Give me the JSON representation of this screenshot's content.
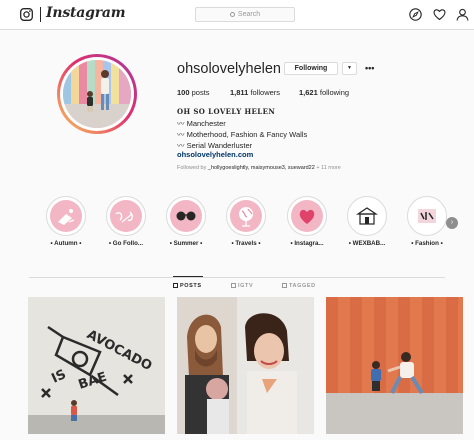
{
  "header": {
    "app_name": "Instagram",
    "search_placeholder": "Search",
    "icons": [
      "instagram-camera-icon",
      "compass-icon",
      "heart-icon",
      "person-icon"
    ]
  },
  "profile": {
    "username": "ohsolovelyhelen",
    "follow_button": "Following",
    "dropdown_glyph": "▼",
    "more_glyph": "•••",
    "stats": {
      "posts_count": "100",
      "posts_label": "posts",
      "followers_count": "1,811",
      "followers_label": "followers",
      "following_count": "1,621",
      "following_label": "following"
    },
    "bio": {
      "name": "OH SO LOVELY HELEN",
      "lines": [
        "〰 Manchester",
        "〰 Motherhood, Fashion & Fancy Walls",
        "〰 Serial Wanderluster"
      ],
      "link": "ohsolovelyhelen.com"
    },
    "followed_by": {
      "prefix": "Followed by",
      "names": "_hollygoeslightly, maisymouse3, sueward22",
      "suffix": "+ 11 more"
    }
  },
  "highlights": [
    {
      "label": "• Autumn •"
    },
    {
      "label": "• Go Follo..."
    },
    {
      "label": "• Summer •"
    },
    {
      "label": "• Travels •"
    },
    {
      "label": "• Instagra..."
    },
    {
      "label": "• WEXBAB..."
    },
    {
      "label": "• Fashion •"
    }
  ],
  "highlights_next": "›",
  "tabs": [
    {
      "label": "POSTS",
      "icon": "grid-icon",
      "active": true
    },
    {
      "label": "IGTV",
      "icon": "igtv-icon",
      "active": false
    },
    {
      "label": "TAGGED",
      "icon": "tag-icon",
      "active": false
    }
  ],
  "posts": [
    {
      "alt": "Mural reading AVOCADO IS BAE with child"
    },
    {
      "alt": "Family selfie"
    },
    {
      "alt": "Mother and child by orange wall"
    }
  ],
  "mural_text": {
    "line1": "AVOCADO",
    "line2": "IS",
    "line3": "BAE"
  },
  "colors": {
    "border": "#dbdbdb",
    "text": "#262626",
    "muted": "#8e8e8e",
    "link": "#003569",
    "highlight_pink": "#f3b6c4"
  }
}
